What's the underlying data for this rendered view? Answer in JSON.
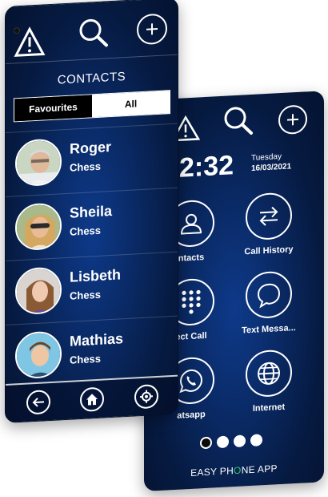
{
  "contacts_screen": {
    "title": "CONTACTS",
    "tabs": [
      {
        "label": "Favourites",
        "selected": true
      },
      {
        "label": "All",
        "selected": false
      }
    ],
    "contacts": [
      {
        "name": "Roger",
        "group": "Chess"
      },
      {
        "name": "Sheila",
        "group": "Chess"
      },
      {
        "name": "Lisbeth",
        "group": "Chess"
      },
      {
        "name": "Mathias",
        "group": "Chess"
      }
    ],
    "top_icons": [
      "warning-icon",
      "search-icon",
      "add-icon"
    ],
    "bottom_nav": [
      "back-icon",
      "home-icon",
      "settings-icon"
    ]
  },
  "home_screen": {
    "clock": "2:32",
    "day": "Tuesday",
    "date": "16/03/2021",
    "tiles": [
      {
        "label": "ntacts",
        "icon": "contacts-icon"
      },
      {
        "label": "Call History",
        "icon": "swap-arrows-icon"
      },
      {
        "label": "ect Call",
        "icon": "dialpad-icon"
      },
      {
        "label": "Text Messa...",
        "icon": "chat-bubble-icon"
      },
      {
        "label": "atsapp",
        "icon": "whatsapp-icon"
      },
      {
        "label": "Internet",
        "icon": "globe-icon"
      }
    ],
    "page_dots": 4,
    "active_dot": 1,
    "brand_prefix": "EASY PH",
    "brand_o": "O",
    "brand_suffix": "NE APP"
  },
  "colors": {
    "background": "#0a2a66",
    "accent_green": "#2ecc71"
  }
}
